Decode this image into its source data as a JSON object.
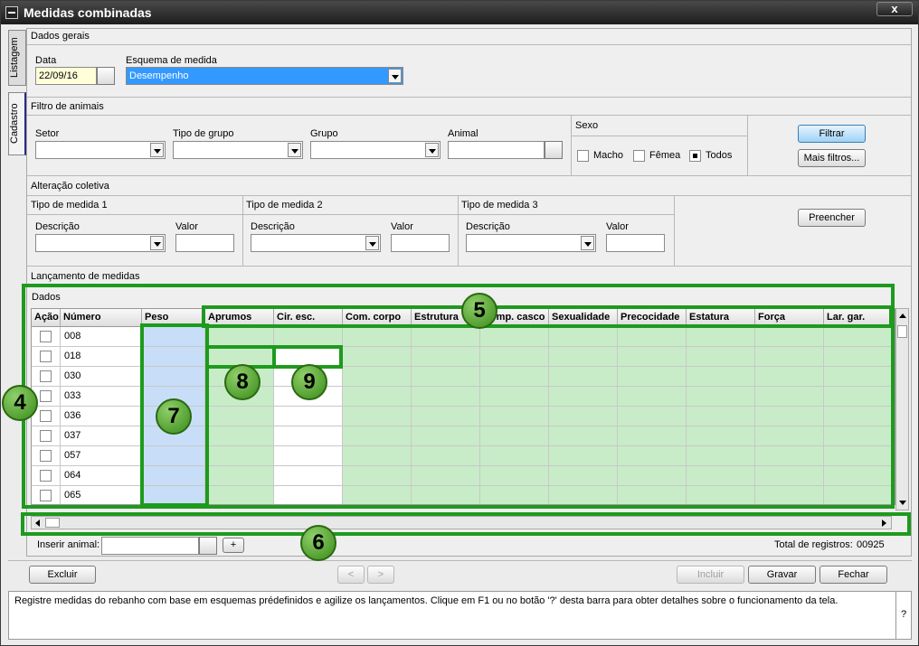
{
  "window": {
    "title": "Medidas combinadas",
    "close_label": "x"
  },
  "side_tabs": [
    {
      "label": "Listagem"
    },
    {
      "label": "Cadastro"
    }
  ],
  "dados_gerais": {
    "section": "Dados gerais",
    "data_label": "Data",
    "data_value": "22/09/16",
    "esquema_label": "Esquema de medida",
    "esquema_value": "Desempenho"
  },
  "filtro": {
    "section": "Filtro de animais",
    "setor": "Setor",
    "tipo_grupo": "Tipo de grupo",
    "grupo": "Grupo",
    "animal": "Animal",
    "sexo": "Sexo",
    "macho": "Macho",
    "femea": "Fêmea",
    "todos": "Todos",
    "filtrar": "Filtrar",
    "mais_filtros": "Mais filtros..."
  },
  "alteracao": {
    "section": "Alteração coletiva",
    "tipo1": "Tipo de medida 1",
    "tipo2": "Tipo de medida 2",
    "tipo3": "Tipo de medida 3",
    "descricao": "Descrição",
    "valor": "Valor",
    "preencher": "Preencher"
  },
  "lancamento": {
    "section": "Lançamento de medidas",
    "dados": "Dados",
    "columns": [
      "Ação",
      "Número",
      "Peso",
      "Aprumos",
      "Cir. esc.",
      "Com. corpo",
      "Estrutura",
      "Comp. casco",
      "Sexualidade",
      "Precocidade",
      "Estatura",
      "Força",
      "Lar. gar."
    ],
    "rows": [
      "008",
      "018",
      "030",
      "033",
      "036",
      "037",
      "057",
      "064",
      "065"
    ],
    "inserir_animal": "Inserir animal:",
    "add_label": "+",
    "total_label": "Total de registros:",
    "total_value": "00925"
  },
  "badges": [
    "4",
    "5",
    "6",
    "7",
    "8",
    "9"
  ],
  "footer": {
    "excluir": "Excluir",
    "prev": "<",
    "next": ">",
    "incluir": "Incluir",
    "gravar": "Gravar",
    "fechar": "Fechar"
  },
  "status": {
    "message": "Registre medidas do rebanho com base em esquemas prédefinidos e agilize os lançamentos. Clique em F1 ou no botão '?' desta barra para obter detalhes sobre o funcionamento da tela.",
    "help": "?"
  },
  "colors": {
    "highlight_green": "#1e9a1e",
    "cell_green": "#c8ecc8",
    "cell_blue": "#c8def8",
    "selection": "#3399ff"
  }
}
